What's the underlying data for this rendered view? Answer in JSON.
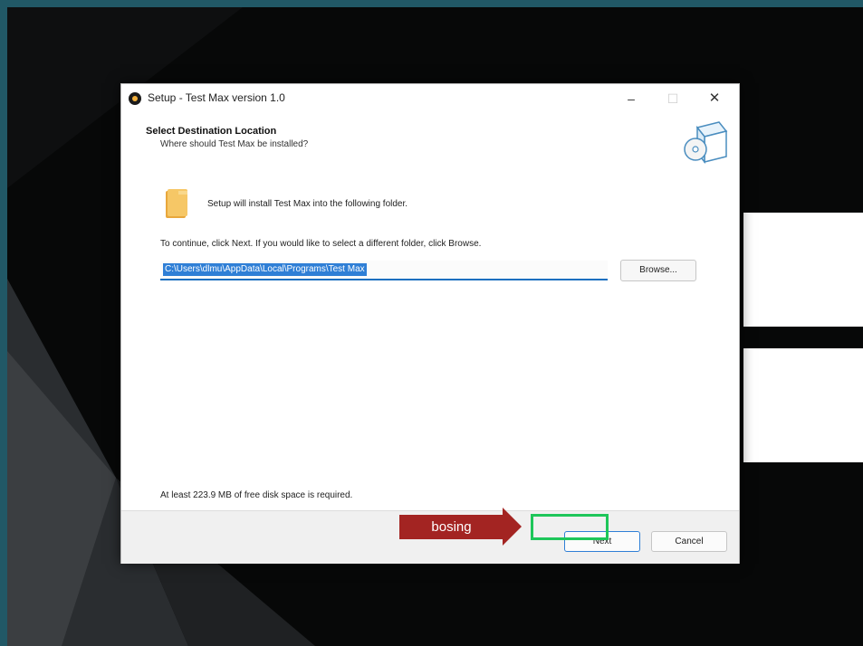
{
  "window": {
    "title": "Setup - Test Max version 1.0",
    "controls": {
      "minimize": "–",
      "maximize": "☐",
      "close": "✕"
    }
  },
  "header": {
    "title": "Select Destination Location",
    "subtitle": "Where should Test Max be installed?"
  },
  "body": {
    "install_text": "Setup will install Test Max into the following folder.",
    "continue_text": "To continue, click Next. If you would like to select a different folder, click Browse.",
    "path_value": "C:\\Users\\dlmu\\AppData\\Local\\Programs\\Test Max",
    "browse_label": "Browse...",
    "disk_space_text": "At least 223.9 MB of free disk space is required."
  },
  "footer": {
    "next_label": "Next",
    "cancel_label": "Cancel"
  },
  "annotation": {
    "arrow_label": "bosing",
    "arrow_color": "#a32422",
    "highlight_color": "#1ec65a"
  },
  "icons": [
    "app-icon",
    "box-icon",
    "folder-icon"
  ],
  "colors": {
    "accent": "#2f7fd6",
    "background_frame": "#215866"
  }
}
